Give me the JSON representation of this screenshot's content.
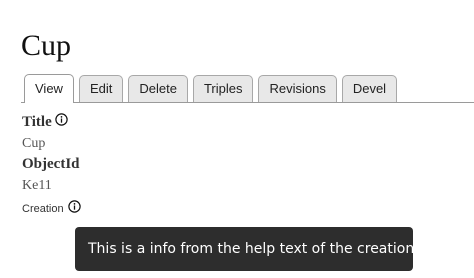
{
  "page": {
    "title": "Cup"
  },
  "tabs": [
    {
      "label": "View",
      "active": true
    },
    {
      "label": "Edit",
      "active": false
    },
    {
      "label": "Delete",
      "active": false
    },
    {
      "label": "Triples",
      "active": false
    },
    {
      "label": "Revisions",
      "active": false
    },
    {
      "label": "Devel",
      "active": false
    }
  ],
  "fields": {
    "title": {
      "label": "Title",
      "value": "Cup",
      "icon": "info-icon"
    },
    "object_id": {
      "label": "ObjectId",
      "value": "Ke11"
    },
    "creation": {
      "label": "Creation",
      "icon": "info-icon"
    }
  },
  "tooltip": {
    "text": "This is a info from the help text of the creation."
  },
  "colors": {
    "tooltip_bg": "#2d2d2d",
    "tab_bg": "#e8e8e8",
    "tab_active_bg": "#ffffff"
  }
}
